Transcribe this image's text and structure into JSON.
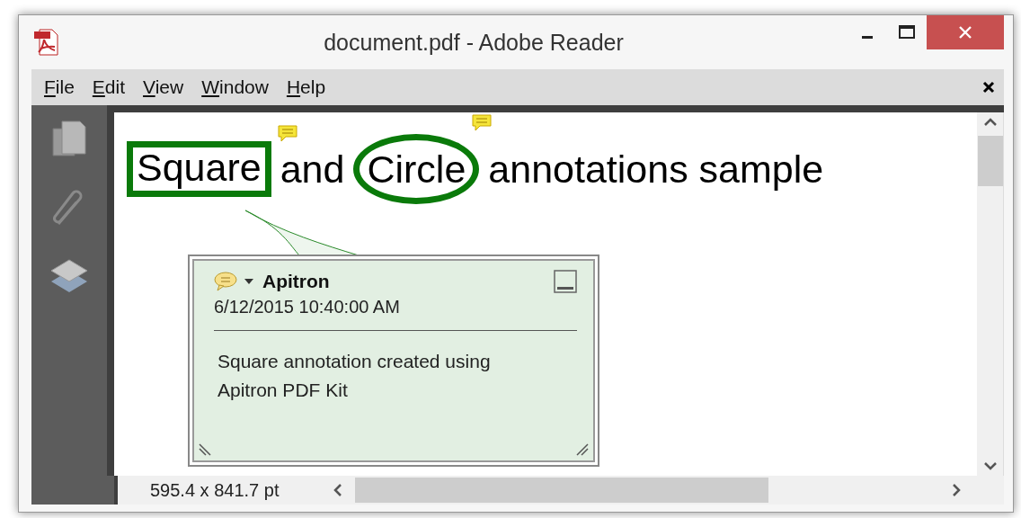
{
  "window": {
    "title": "document.pdf - Adobe Reader"
  },
  "menu": [
    {
      "label": "File"
    },
    {
      "label": "Edit"
    },
    {
      "label": "View"
    },
    {
      "label": "Window"
    },
    {
      "label": "Help"
    }
  ],
  "heading": [
    {
      "kind": "square",
      "text": "Square"
    },
    {
      "kind": "plain",
      "text": "and"
    },
    {
      "kind": "circle",
      "text": "Circle"
    },
    {
      "kind": "plain",
      "text": "annotations sample"
    }
  ],
  "popup": {
    "author": "Apitron",
    "date": "6/12/2015 10:40:00 AM",
    "body": "Square annotation created using Apitron PDF Kit"
  },
  "status_bar": {
    "page_size": "595.4 x 841.7 pt"
  }
}
